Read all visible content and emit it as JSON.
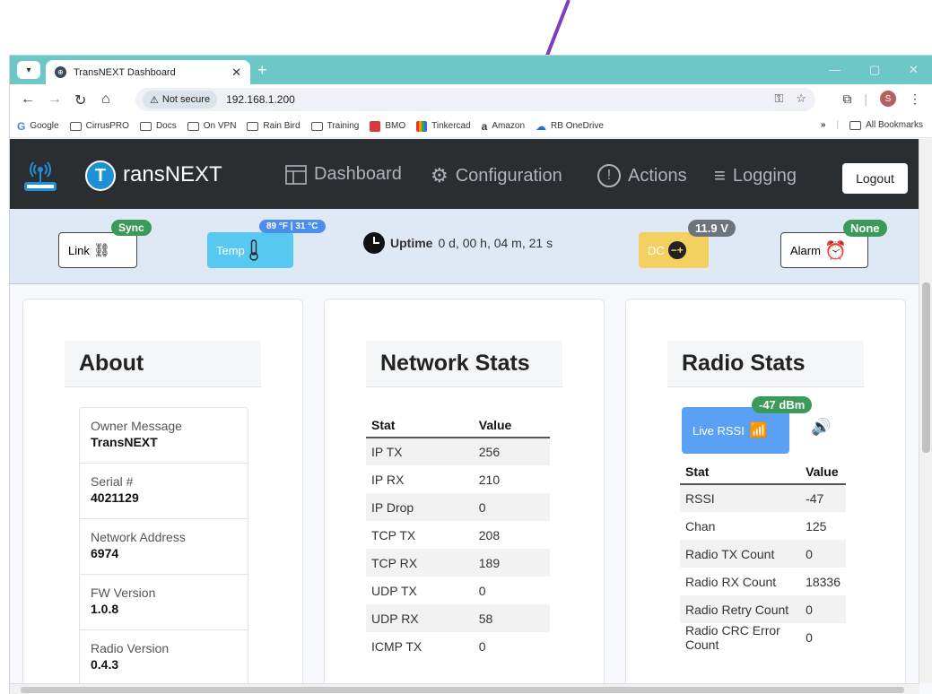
{
  "browser": {
    "tab_title": "TransNEXT Dashboard",
    "security_label": "Not secure",
    "url": "192.168.1.200",
    "profile_initial": "S",
    "bookmarks": [
      "Google",
      "CirrusPRO",
      "Docs",
      "On VPN",
      "Rain Bird",
      "Training",
      "BMO",
      "Tinkercad",
      "Amazon",
      "RB OneDrive"
    ],
    "all_bookmarks": "All Bookmarks"
  },
  "app": {
    "logo_letter": "T",
    "brand": "ransNEXT",
    "nav": [
      "Dashboard",
      "Configuration",
      "Actions",
      "Logging"
    ],
    "logout": "Logout"
  },
  "status": {
    "link_label": "Link",
    "link_badge": "Sync",
    "temp_label": "Temp",
    "temp_badge": "89 °F | 31 °C",
    "uptime_label": "Uptime",
    "uptime_value": "0 d, 00 h, 04 m, 21 s",
    "dc_label": "DC",
    "dc_badge": "11.9 V",
    "alarm_label": "Alarm",
    "alarm_badge": "None"
  },
  "about": {
    "title": "About",
    "items": [
      {
        "label": "Owner Message",
        "value": "TransNEXT"
      },
      {
        "label": "Serial #",
        "value": "4021129"
      },
      {
        "label": "Network Address",
        "value": "6974"
      },
      {
        "label": "FW Version",
        "value": "1.0.8"
      },
      {
        "label": "Radio Version",
        "value": "0.4.3"
      }
    ]
  },
  "network": {
    "title": "Network Stats",
    "headers": [
      "Stat",
      "Value"
    ],
    "rows": [
      [
        "IP TX",
        "256"
      ],
      [
        "IP RX",
        "210"
      ],
      [
        "IP Drop",
        "0"
      ],
      [
        "TCP TX",
        "208"
      ],
      [
        "TCP RX",
        "189"
      ],
      [
        "UDP TX",
        "0"
      ],
      [
        "UDP RX",
        "58"
      ],
      [
        "ICMP TX",
        "0"
      ]
    ]
  },
  "radio": {
    "title": "Radio Stats",
    "rssi_button": "Live RSSI",
    "rssi_badge": "-47 dBm",
    "headers": [
      "Stat",
      "Value"
    ],
    "rows": [
      [
        "RSSI",
        "-47"
      ],
      [
        "Chan",
        "125"
      ],
      [
        "Radio TX Count",
        "0"
      ],
      [
        "Radio RX Count",
        "18336"
      ],
      [
        "Radio Retry Count",
        "0"
      ],
      [
        "Radio CRC Error Count",
        "0"
      ]
    ]
  },
  "colors": {
    "tabbar": "#6cc7c6",
    "navbar": "#2b2e31",
    "status_bg": "#dfe9f6",
    "badge_green": "#3a9a5a",
    "badge_blue": "#4a8ff0",
    "badge_grey": "#6c757d",
    "temp_card": "#57c8f0",
    "dc_card": "#f4d060",
    "rssi_button": "#5aa1f3",
    "annotation_arrow": "#7b3fbf"
  }
}
